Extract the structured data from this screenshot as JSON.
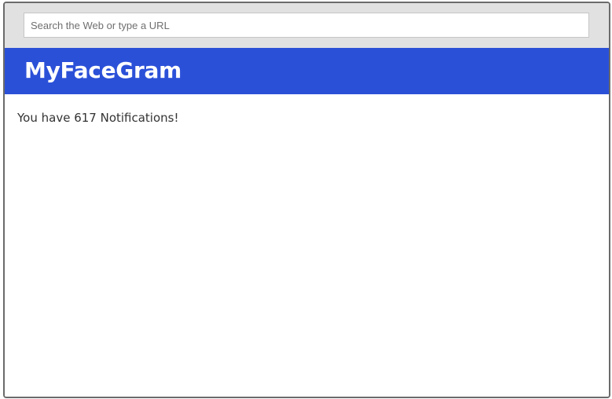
{
  "browser": {
    "address_bar": {
      "value": "",
      "placeholder": "Search the Web or type a URL"
    }
  },
  "site": {
    "title": "MyFaceGram",
    "brand_color": "#2b50d8"
  },
  "main": {
    "notification_message": "You have 617 Notifications!"
  }
}
